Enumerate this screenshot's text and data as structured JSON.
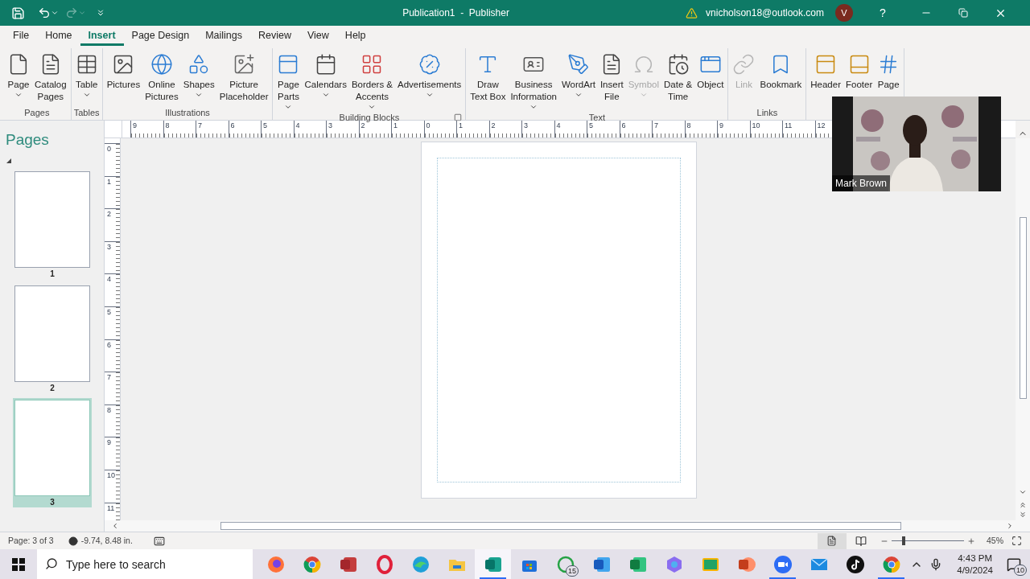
{
  "title_bar": {
    "title": "Publication1  -  Publisher",
    "account": "vnicholson18@outlook.com",
    "avatar": "V",
    "help": "?"
  },
  "menu_tabs": [
    {
      "label": "File",
      "selected": false
    },
    {
      "label": "Home",
      "selected": false
    },
    {
      "label": "Insert",
      "selected": true
    },
    {
      "label": "Page Design",
      "selected": false
    },
    {
      "label": "Mailings",
      "selected": false
    },
    {
      "label": "Review",
      "selected": false
    },
    {
      "label": "View",
      "selected": false
    },
    {
      "label": "Help",
      "selected": false
    }
  ],
  "ribbon_groups": [
    {
      "label": "Pages",
      "launcher": false,
      "commands": [
        {
          "kind": "page",
          "lines": [
            "Page"
          ],
          "dropdown": true,
          "disabled": false
        },
        {
          "kind": "catalog",
          "lines": [
            "Catalog",
            "Pages"
          ],
          "dropdown": false,
          "disabled": false
        }
      ]
    },
    {
      "label": "Tables",
      "launcher": false,
      "commands": [
        {
          "kind": "table",
          "lines": [
            "Table"
          ],
          "dropdown": true,
          "disabled": false
        }
      ]
    },
    {
      "label": "Illustrations",
      "launcher": false,
      "commands": [
        {
          "kind": "pictures",
          "lines": [
            "Pictures"
          ],
          "dropdown": false,
          "disabled": false
        },
        {
          "kind": "online",
          "lines": [
            "Online",
            "Pictures"
          ],
          "dropdown": false,
          "disabled": false
        },
        {
          "kind": "shapes",
          "lines": [
            "Shapes"
          ],
          "dropdown": true,
          "disabled": false
        },
        {
          "kind": "placeholder",
          "lines": [
            "Picture",
            "Placeholder"
          ],
          "dropdown": false,
          "disabled": false
        }
      ]
    },
    {
      "label": "Building Blocks",
      "launcher": true,
      "commands": [
        {
          "kind": "parts",
          "lines": [
            "Page",
            "Parts"
          ],
          "dropdown": true,
          "disabled": false
        },
        {
          "kind": "calendar",
          "lines": [
            "Calendars"
          ],
          "dropdown": true,
          "disabled": false
        },
        {
          "kind": "borders",
          "lines": [
            "Borders &",
            "Accents"
          ],
          "dropdown": true,
          "disabled": false
        },
        {
          "kind": "ads",
          "lines": [
            "Advertisements"
          ],
          "dropdown": true,
          "disabled": false
        }
      ]
    },
    {
      "label": "Text",
      "launcher": false,
      "commands": [
        {
          "kind": "textbox",
          "lines": [
            "Draw",
            "Text Box"
          ],
          "dropdown": false,
          "disabled": false
        },
        {
          "kind": "business",
          "lines": [
            "Business",
            "Information"
          ],
          "dropdown": true,
          "disabled": false
        },
        {
          "kind": "wordart",
          "lines": [
            "WordArt"
          ],
          "dropdown": true,
          "disabled": false
        },
        {
          "kind": "file",
          "lines": [
            "Insert",
            "File"
          ],
          "dropdown": false,
          "disabled": false
        },
        {
          "kind": "symbol",
          "lines": [
            "Symbol"
          ],
          "dropdown": true,
          "disabled": true
        },
        {
          "kind": "datetime",
          "lines": [
            "Date &",
            "Time"
          ],
          "dropdown": false,
          "disabled": false
        },
        {
          "kind": "object",
          "lines": [
            "Object"
          ],
          "dropdown": false,
          "disabled": false
        }
      ]
    },
    {
      "label": "Links",
      "launcher": false,
      "commands": [
        {
          "kind": "link",
          "lines": [
            "Link"
          ],
          "dropdown": false,
          "disabled": true
        },
        {
          "kind": "bookmark",
          "lines": [
            "Bookmark"
          ],
          "dropdown": false,
          "disabled": false
        }
      ]
    },
    {
      "commands": [
        {
          "kind": "header",
          "lines": [
            "Header"
          ],
          "dropdown": false,
          "disabled": false
        },
        {
          "kind": "footer",
          "lines": [
            "Footer"
          ],
          "dropdown": false,
          "disabled": false
        },
        {
          "kind": "pagenumber",
          "lines": [
            "Page"
          ],
          "dropdown": false,
          "disabled": false
        }
      ]
    }
  ],
  "pages_pane": {
    "title": "Pages",
    "thumbnails": [
      {
        "number": "1",
        "selected": false
      },
      {
        "number": "2",
        "selected": false
      },
      {
        "number": "3",
        "selected": true
      }
    ]
  },
  "ruler": {
    "horizontal": [
      "9",
      "8",
      "7",
      "6",
      "5",
      "4",
      "3",
      "2",
      "1",
      "0",
      "1",
      "2",
      "3",
      "4",
      "5",
      "6",
      "7",
      "8",
      "9",
      "10",
      "11",
      "12"
    ],
    "vertical": [
      "0",
      "1",
      "2",
      "3",
      "4",
      "5",
      "6",
      "7",
      "8",
      "9",
      "10",
      "11"
    ]
  },
  "video": {
    "name": "Mark Brown"
  },
  "status_bar": {
    "page": "Page: 3 of 3",
    "position": "-9.74, 8.48 in.",
    "zoom": "45%",
    "zoom_slider": {
      "level": 0.17
    }
  },
  "taskbar": {
    "search_placeholder": "Type here to search",
    "apps": [
      {
        "kind": "firefox",
        "running": false,
        "selected": false
      },
      {
        "kind": "chrome",
        "running": false,
        "selected": false
      },
      {
        "kind": "access",
        "running": false,
        "selected": false
      },
      {
        "kind": "opera",
        "running": false,
        "selected": false
      },
      {
        "kind": "edge",
        "running": false,
        "selected": false
      },
      {
        "kind": "explorer",
        "running": false,
        "selected": false
      },
      {
        "kind": "publisher",
        "running": true,
        "selected": true
      },
      {
        "kind": "store",
        "running": false,
        "selected": false
      },
      {
        "kind": "whatsapp",
        "badge": "15",
        "running": false,
        "selected": false
      },
      {
        "kind": "word",
        "running": false,
        "selected": false
      },
      {
        "kind": "excel",
        "running": false,
        "selected": false
      },
      {
        "kind": "copilot",
        "running": false,
        "selected": false
      },
      {
        "kind": "classroom",
        "running": false,
        "selected": false
      },
      {
        "kind": "powerpoint",
        "running": false,
        "selected": false
      },
      {
        "kind": "zoom",
        "running": true,
        "selected": false
      },
      {
        "kind": "mail",
        "running": false,
        "selected": false
      },
      {
        "kind": "tiktok",
        "running": false,
        "selected": false
      },
      {
        "kind": "chrome",
        "running": true,
        "selected": false
      }
    ],
    "time": "4:43 PM",
    "date": "4/9/2024",
    "notifications": "10"
  }
}
